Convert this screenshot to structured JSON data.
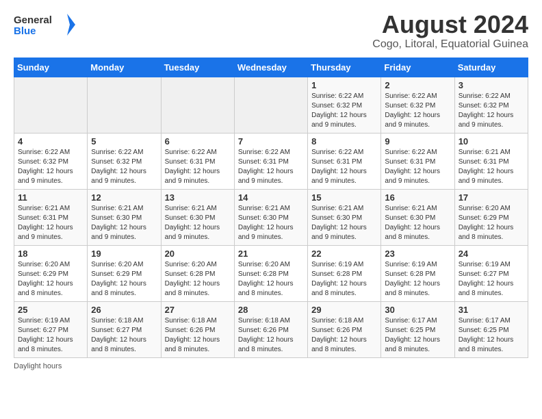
{
  "header": {
    "logo_general": "General",
    "logo_blue": "Blue",
    "main_title": "August 2024",
    "subtitle": "Cogo, Litoral, Equatorial Guinea"
  },
  "days_of_week": [
    "Sunday",
    "Monday",
    "Tuesday",
    "Wednesday",
    "Thursday",
    "Friday",
    "Saturday"
  ],
  "weeks": [
    [
      {
        "day": "",
        "info": ""
      },
      {
        "day": "",
        "info": ""
      },
      {
        "day": "",
        "info": ""
      },
      {
        "day": "",
        "info": ""
      },
      {
        "day": "1",
        "info": "Sunrise: 6:22 AM\nSunset: 6:32 PM\nDaylight: 12 hours and 9 minutes."
      },
      {
        "day": "2",
        "info": "Sunrise: 6:22 AM\nSunset: 6:32 PM\nDaylight: 12 hours and 9 minutes."
      },
      {
        "day": "3",
        "info": "Sunrise: 6:22 AM\nSunset: 6:32 PM\nDaylight: 12 hours and 9 minutes."
      }
    ],
    [
      {
        "day": "4",
        "info": "Sunrise: 6:22 AM\nSunset: 6:32 PM\nDaylight: 12 hours and 9 minutes."
      },
      {
        "day": "5",
        "info": "Sunrise: 6:22 AM\nSunset: 6:32 PM\nDaylight: 12 hours and 9 minutes."
      },
      {
        "day": "6",
        "info": "Sunrise: 6:22 AM\nSunset: 6:31 PM\nDaylight: 12 hours and 9 minutes."
      },
      {
        "day": "7",
        "info": "Sunrise: 6:22 AM\nSunset: 6:31 PM\nDaylight: 12 hours and 9 minutes."
      },
      {
        "day": "8",
        "info": "Sunrise: 6:22 AM\nSunset: 6:31 PM\nDaylight: 12 hours and 9 minutes."
      },
      {
        "day": "9",
        "info": "Sunrise: 6:22 AM\nSunset: 6:31 PM\nDaylight: 12 hours and 9 minutes."
      },
      {
        "day": "10",
        "info": "Sunrise: 6:21 AM\nSunset: 6:31 PM\nDaylight: 12 hours and 9 minutes."
      }
    ],
    [
      {
        "day": "11",
        "info": "Sunrise: 6:21 AM\nSunset: 6:31 PM\nDaylight: 12 hours and 9 minutes."
      },
      {
        "day": "12",
        "info": "Sunrise: 6:21 AM\nSunset: 6:30 PM\nDaylight: 12 hours and 9 minutes."
      },
      {
        "day": "13",
        "info": "Sunrise: 6:21 AM\nSunset: 6:30 PM\nDaylight: 12 hours and 9 minutes."
      },
      {
        "day": "14",
        "info": "Sunrise: 6:21 AM\nSunset: 6:30 PM\nDaylight: 12 hours and 9 minutes."
      },
      {
        "day": "15",
        "info": "Sunrise: 6:21 AM\nSunset: 6:30 PM\nDaylight: 12 hours and 9 minutes."
      },
      {
        "day": "16",
        "info": "Sunrise: 6:21 AM\nSunset: 6:30 PM\nDaylight: 12 hours and 8 minutes."
      },
      {
        "day": "17",
        "info": "Sunrise: 6:20 AM\nSunset: 6:29 PM\nDaylight: 12 hours and 8 minutes."
      }
    ],
    [
      {
        "day": "18",
        "info": "Sunrise: 6:20 AM\nSunset: 6:29 PM\nDaylight: 12 hours and 8 minutes."
      },
      {
        "day": "19",
        "info": "Sunrise: 6:20 AM\nSunset: 6:29 PM\nDaylight: 12 hours and 8 minutes."
      },
      {
        "day": "20",
        "info": "Sunrise: 6:20 AM\nSunset: 6:28 PM\nDaylight: 12 hours and 8 minutes."
      },
      {
        "day": "21",
        "info": "Sunrise: 6:20 AM\nSunset: 6:28 PM\nDaylight: 12 hours and 8 minutes."
      },
      {
        "day": "22",
        "info": "Sunrise: 6:19 AM\nSunset: 6:28 PM\nDaylight: 12 hours and 8 minutes."
      },
      {
        "day": "23",
        "info": "Sunrise: 6:19 AM\nSunset: 6:28 PM\nDaylight: 12 hours and 8 minutes."
      },
      {
        "day": "24",
        "info": "Sunrise: 6:19 AM\nSunset: 6:27 PM\nDaylight: 12 hours and 8 minutes."
      }
    ],
    [
      {
        "day": "25",
        "info": "Sunrise: 6:19 AM\nSunset: 6:27 PM\nDaylight: 12 hours and 8 minutes."
      },
      {
        "day": "26",
        "info": "Sunrise: 6:18 AM\nSunset: 6:27 PM\nDaylight: 12 hours and 8 minutes."
      },
      {
        "day": "27",
        "info": "Sunrise: 6:18 AM\nSunset: 6:26 PM\nDaylight: 12 hours and 8 minutes."
      },
      {
        "day": "28",
        "info": "Sunrise: 6:18 AM\nSunset: 6:26 PM\nDaylight: 12 hours and 8 minutes."
      },
      {
        "day": "29",
        "info": "Sunrise: 6:18 AM\nSunset: 6:26 PM\nDaylight: 12 hours and 8 minutes."
      },
      {
        "day": "30",
        "info": "Sunrise: 6:17 AM\nSunset: 6:25 PM\nDaylight: 12 hours and 8 minutes."
      },
      {
        "day": "31",
        "info": "Sunrise: 6:17 AM\nSunset: 6:25 PM\nDaylight: 12 hours and 8 minutes."
      }
    ]
  ],
  "footer": {
    "note": "Daylight hours"
  }
}
